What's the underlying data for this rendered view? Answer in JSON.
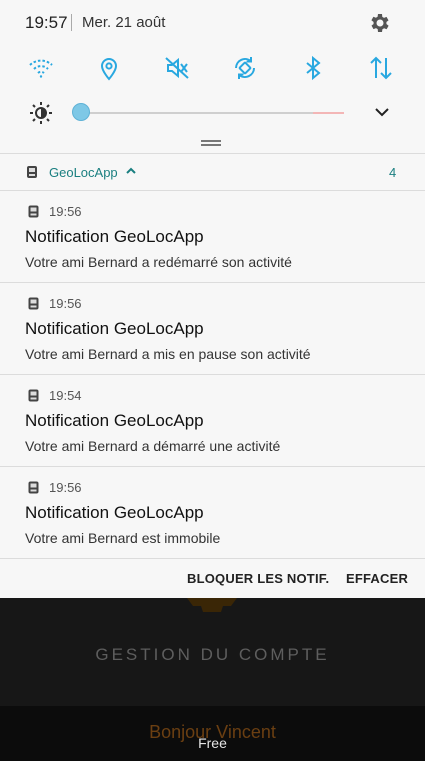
{
  "status": {
    "time": "19:57",
    "date": "Mer. 21 août"
  },
  "quick_settings": {
    "toggles": [
      "wifi-icon",
      "location-icon",
      "sound-off-icon",
      "auto-rotate-icon",
      "bluetooth-icon",
      "mobile-data-icon"
    ],
    "accent": "#29a8e0",
    "brightness": 0.0
  },
  "app_group": {
    "name": "GeoLocApp",
    "count": "4",
    "color": "#1a7f80"
  },
  "notifications": [
    {
      "time": "19:56",
      "title": "Notification GeoLocApp",
      "text": "Votre ami Bernard  a redémarré son activité"
    },
    {
      "time": "19:56",
      "title": "Notification GeoLocApp",
      "text": "Votre ami Bernard  a mis en pause son activité"
    },
    {
      "time": "19:54",
      "title": "Notification GeoLocApp",
      "text": "Votre ami Bernard  a démarré une activité"
    },
    {
      "time": "19:56",
      "title": "Notification GeoLocApp",
      "text": "Votre ami Bernard  est immobile"
    }
  ],
  "actions": {
    "block": "BLOQUER LES NOTIF.",
    "clear": "EFFACER"
  },
  "background_app": {
    "title": "GESTION DU COMPTE",
    "greeting": "Bonjour Vincent",
    "carrier": "Free"
  }
}
